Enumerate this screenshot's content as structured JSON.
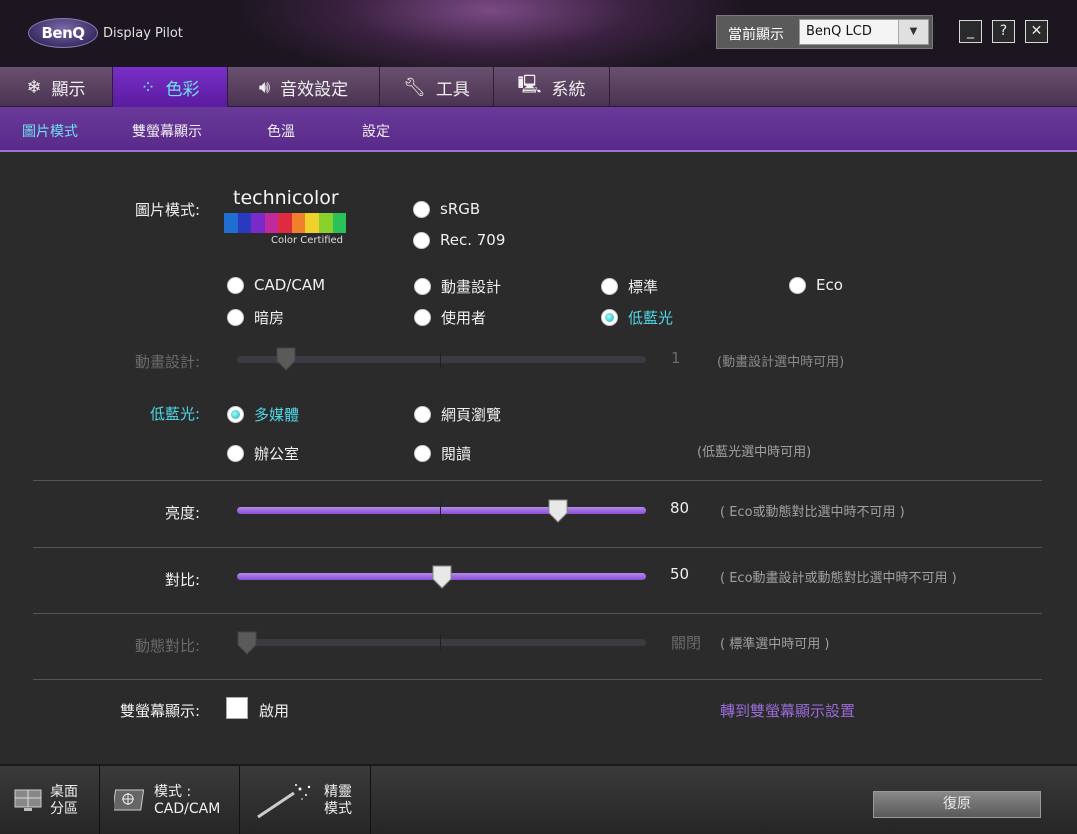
{
  "header": {
    "logo_text": "BenQ",
    "app_title": "Display Pilot",
    "monitor_label": "當前顯示",
    "monitor_value": "BenQ LCD",
    "minimize": "_",
    "help": "?",
    "close": "✕"
  },
  "tabs": [
    {
      "label": "顯示",
      "icon": "snowflake-icon"
    },
    {
      "label": "色彩",
      "icon": "color-dots-icon"
    },
    {
      "label": "音效設定",
      "icon": "speaker-icon"
    },
    {
      "label": "工具",
      "icon": "wrench-icon"
    },
    {
      "label": "系統",
      "icon": "monitor-icon"
    }
  ],
  "subtabs": [
    "圖片模式",
    "雙螢幕顯示",
    "色溫",
    "設定"
  ],
  "picture_mode": {
    "label": "圖片模式:",
    "technicolor_word": "technicolor",
    "technicolor_cert": "Color Certified",
    "options": [
      "sRGB",
      "Rec. 709",
      "CAD/CAM",
      "動畫設計",
      "標準",
      "Eco",
      "暗房",
      "使用者",
      "低藍光"
    ],
    "selected": "低藍光"
  },
  "animation": {
    "label": "動畫設計:",
    "value": "1",
    "note": "(動畫設計選中時可用)",
    "level": 0.1
  },
  "low_blue": {
    "label": "低藍光:",
    "options": [
      "多媒體",
      "網頁瀏覽",
      "辦公室",
      "閱讀"
    ],
    "selected": "多媒體",
    "note": "(低藍光選中時可用)"
  },
  "brightness": {
    "label": "亮度:",
    "value": "80",
    "level": 0.8,
    "note": "( Eco或動態對比選中時不可用 )"
  },
  "contrast": {
    "label": "對比:",
    "value": "50",
    "level": 0.5,
    "note": "( Eco動畫設計或動態對比選中時不可用 )"
  },
  "dynamic_contrast": {
    "label": "動態對比:",
    "value": "關閉",
    "level": 0,
    "note": "( 標準選中時可用 )"
  },
  "dual_display": {
    "label": "雙螢幕顯示:",
    "checkbox_label": "啟用",
    "link": "轉到雙螢幕顯示設置"
  },
  "bottom": {
    "desktop_line1": "桌面",
    "desktop_line2": "分區",
    "mode_line1": "模式 :",
    "mode_line2": "CAD/CAM",
    "wizard_line1": "精靈",
    "wizard_line2": "模式",
    "restore": "復原"
  }
}
